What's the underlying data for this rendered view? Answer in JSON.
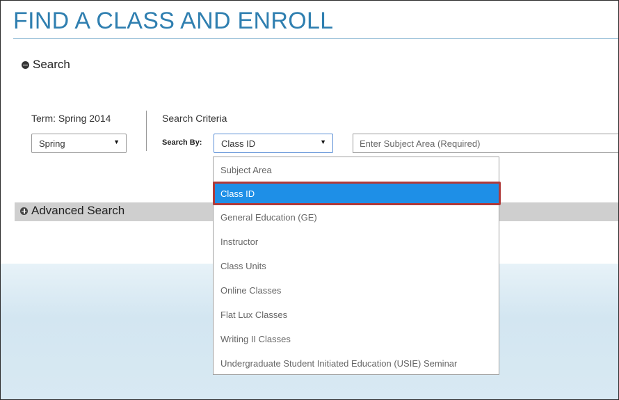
{
  "page": {
    "title": "FIND A CLASS AND ENROLL"
  },
  "search_section": {
    "label": "Search",
    "icon": "minus-circle-icon"
  },
  "term": {
    "label": "Term: Spring 2014",
    "selected": "Spring"
  },
  "criteria": {
    "label": "Search Criteria",
    "search_by_label": "Search By:",
    "search_by_selected": "Class ID",
    "subject_placeholder": "Enter Subject Area (Required)"
  },
  "dropdown": {
    "options": [
      "Subject Area",
      "Class ID",
      "General Education (GE)",
      "Instructor",
      "Class Units",
      "Online Classes",
      "Flat Lux Classes",
      "Writing II Classes",
      "Undergraduate Student Initiated Education (USIE) Seminar"
    ],
    "selected_index": 1,
    "highlight_color": "#1e8fe7",
    "annotation_border_color": "#b03a3a"
  },
  "advanced_section": {
    "label": "Advanced Search",
    "icon": "plus-circle-icon"
  },
  "colors": {
    "title": "#2f7fb0",
    "advanced_bar": "#cfcfcf"
  }
}
